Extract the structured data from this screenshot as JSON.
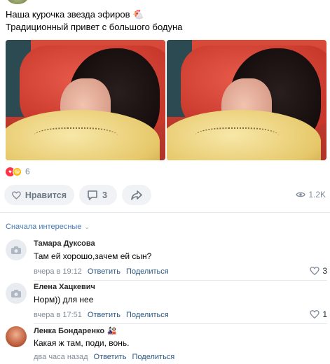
{
  "post": {
    "line1": "Наша курочка звезда эфиров 🐔",
    "line2": "Традиционный привет с большого бодуна"
  },
  "photos": [
    {
      "alt": "photo-1"
    },
    {
      "alt": "photo-2"
    }
  ],
  "reactions": {
    "count": "6",
    "icons": [
      "heart-reaction-icon",
      "laugh-reaction-icon"
    ]
  },
  "actions": {
    "like_label": "Нравится",
    "comment_count": "3",
    "views": "1.2K"
  },
  "comments_sort": "Сначала интересные",
  "comments": [
    {
      "author": "Тамара Дуксова",
      "text": "Там ей хорошо,зачем ей сын?",
      "time": "вчера в 19:12",
      "reply": "Ответить",
      "share": "Поделиться",
      "likes": "3"
    },
    {
      "author": "Елена Хацкевич",
      "text": "Норм)) для нее",
      "time": "вчера в 17:51",
      "reply": "Ответить",
      "share": "Поделиться",
      "likes": "1"
    },
    {
      "author": "Ленка Бондаренко",
      "badge": "🎎",
      "text": "Какая ж там, поди, вонь.",
      "time": "два часа назад",
      "reply": "Ответить",
      "share": "Поделиться",
      "likes": ""
    }
  ],
  "colors": {
    "link": "#2a5885",
    "sort_link": "#447bba",
    "meta": "#818c99",
    "button_bg": "#f0f2f5",
    "heart": "#ff3347"
  }
}
